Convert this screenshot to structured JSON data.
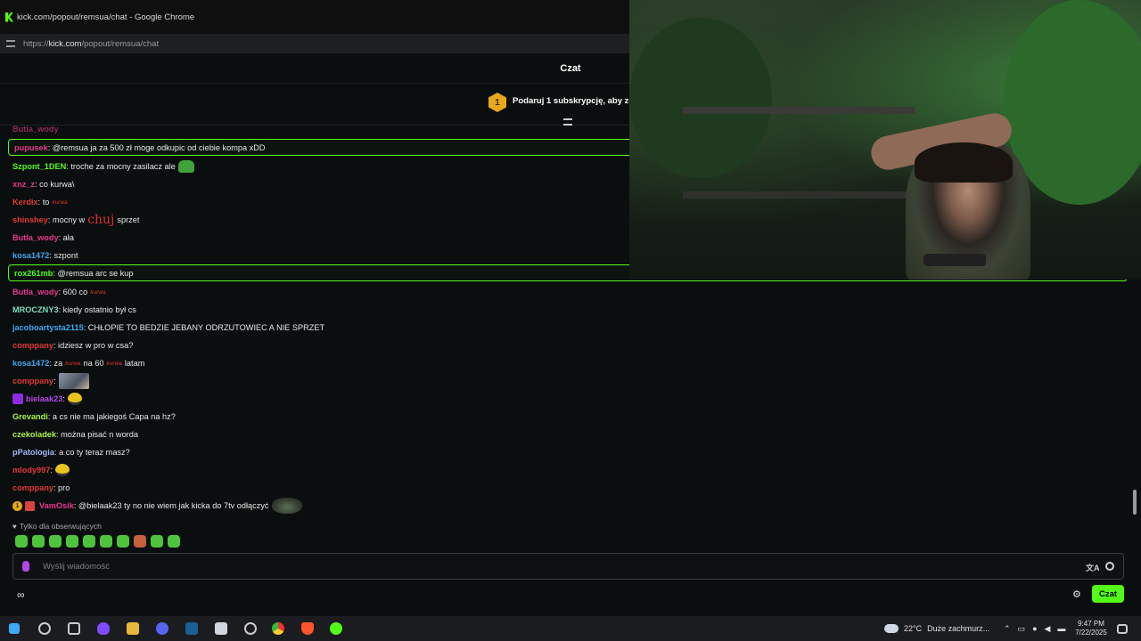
{
  "browser": {
    "window_title": "kick.com/popout/remsua/chat - Google Chrome",
    "url_prefix": "https://",
    "url_host": "kick.com",
    "url_path": "/popout/remsua/chat"
  },
  "chat": {
    "title": "Czat",
    "sub_banner": {
      "badge": "1",
      "text": "Podaruj 1 subskrypcję, aby zdobyć"
    },
    "messages": [
      {
        "user": "pupusek",
        "color": "#e7378f",
        "text": ": @remsua ja za 500 zł moge odkupic od ciebie kompa xDD",
        "highlight": true
      },
      {
        "user": "Szpont_1DEN",
        "color": "#53fc18",
        "text": ": troche za mocny zasilacz ale",
        "emote": "pepe"
      },
      {
        "user": "xnz_z",
        "color": "#e7378f",
        "text": ": co kurwa\\"
      },
      {
        "user": "Kerdix",
        "color": "#e03a35",
        "text": ": to",
        "emote": "kurwa"
      },
      {
        "user": "shinshey",
        "color": "#e03a35",
        "text": ": mocny w",
        "emote": "chuj",
        "after": "sprzet"
      },
      {
        "user": "Butla_wody",
        "color": "#e7378f",
        "text": ": ała"
      },
      {
        "user": "kosa1472",
        "color": "#3fa9f5",
        "text": ": szpont"
      },
      {
        "user": "rox261mb",
        "color": "#53fc18",
        "text": ": @remsua arc se kup",
        "highlight": true
      },
      {
        "user": "Butla_wody",
        "color": "#e7378f",
        "text": ": 600 co",
        "emote": "kurwa"
      },
      {
        "user": "MROCZNY3",
        "color": "#7fdcbc",
        "text": ": kiedy ostatnio był cs"
      },
      {
        "user": "jacoboartysta2115",
        "color": "#3fa9f5",
        "text": ": CHŁOPIE TO BEDZIE JEBANY ODRZUTOWIEC A NIE SPRZET"
      },
      {
        "user": "comppany",
        "color": "#e03a35",
        "text": ": idziesz w pro w csa?"
      },
      {
        "user": "kosa1472",
        "color": "#3fa9f5",
        "text": ": za",
        "emote": "kurwa",
        "middle": "na 60",
        "emote2": "kurwa",
        "after": "latam"
      },
      {
        "user": "comppany",
        "color": "#e03a35",
        "text": ":",
        "emote": "photo"
      },
      {
        "user": "bielaak23",
        "color": "#b148e6",
        "text": ":",
        "emote": "face",
        "subicon": true
      },
      {
        "user": "Grevandi",
        "color": "#a8f04b",
        "text": ": a cs nie ma jakiegoś Capa na hz?"
      },
      {
        "user": "czekoladek",
        "color": "#a8f04b",
        "text": ": można pisać n worda"
      },
      {
        "user": "pPatologia",
        "color": "#9fb8f5",
        "text": ": a co ty teraz masz?"
      },
      {
        "user": "mlody997",
        "color": "#e03a35",
        "text": ":",
        "emote": "face"
      },
      {
        "user": "comppany",
        "color": "#e03a35",
        "text": ": pro"
      },
      {
        "user": "VamOsik",
        "color": "#e7378f",
        "text": ": @bielaak23 ty no nie wiem jak kicka do 7tv odłączyć",
        "emote": "rock",
        "badges": true
      }
    ],
    "partial_top_user": "Butla_wody",
    "emote_kurwa_text": "kurwa",
    "emote_chuj_text": "chuj",
    "followers_only": "Tylko dla obserwujących",
    "input_placeholder": "Wyślij wiadomość",
    "send_label": "Czat",
    "infinity_label": "∞"
  },
  "taskbar": {
    "weather_temp": "22°C",
    "weather_desc": "Duże zachmurz...",
    "time": "9:47 PM",
    "date": "7/22/2025"
  },
  "colors": {
    "accent": "#53fc18",
    "background": "#0b0e0f"
  }
}
